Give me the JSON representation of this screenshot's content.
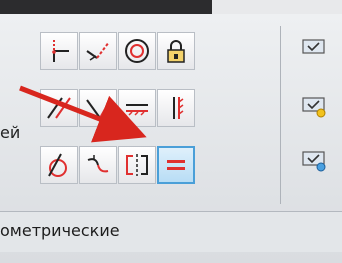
{
  "ribbon": {
    "side_label": "ей",
    "panel_title": "ометрические"
  },
  "colors": {
    "accent_red": "#e03030",
    "active_border": "#4a9fd8",
    "annotation_arrow": "#d8261e"
  },
  "tools": [
    {
      "name": "coincident-icon"
    },
    {
      "name": "collinear-icon"
    },
    {
      "name": "concentric-icon"
    },
    {
      "name": "fix-lock-icon"
    },
    {
      "name": "parallel-icon"
    },
    {
      "name": "perpendicular-icon"
    },
    {
      "name": "horizontal-icon"
    },
    {
      "name": "vertical-icon"
    },
    {
      "name": "tangent-icon"
    },
    {
      "name": "smooth-icon"
    },
    {
      "name": "symmetric-icon"
    },
    {
      "name": "equal-icon",
      "active": true
    }
  ],
  "right_tools": [
    {
      "name": "show-constraints-icon"
    },
    {
      "name": "show-all-constraints-icon"
    },
    {
      "name": "hide-all-constraints-icon"
    }
  ],
  "annotation": {
    "type": "red-arrow",
    "target": "smooth-icon"
  }
}
